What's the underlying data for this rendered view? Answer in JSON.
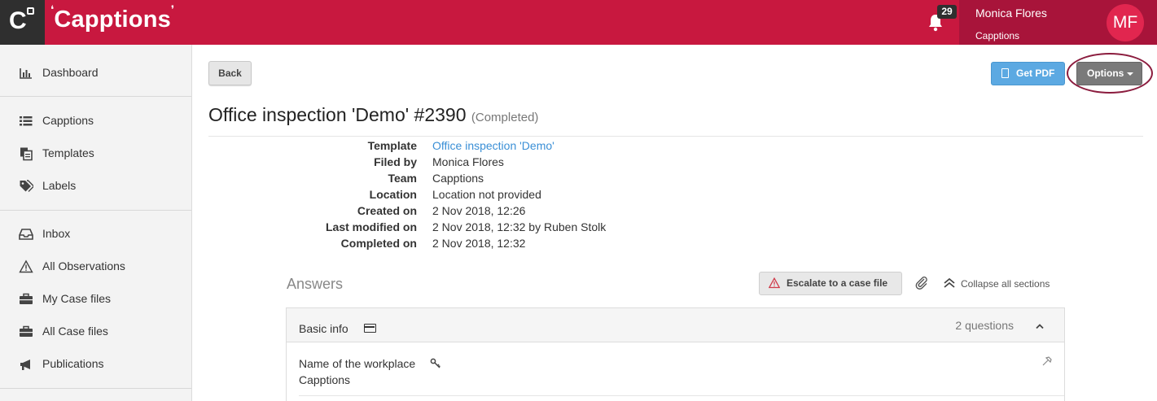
{
  "header": {
    "brand": "Capptions",
    "notification_count": "29",
    "user_name": "Monica Flores",
    "user_team": "Capptions",
    "user_initials": "MF"
  },
  "sidebar": {
    "items": [
      {
        "label": "Dashboard",
        "icon": "bar-chart-icon"
      },
      {
        "label": "Capptions",
        "icon": "list-icon"
      },
      {
        "label": "Templates",
        "icon": "copy-icon"
      },
      {
        "label": "Labels",
        "icon": "tags-icon"
      },
      {
        "label": "Inbox",
        "icon": "inbox-icon"
      },
      {
        "label": "All Observations",
        "icon": "warning-icon"
      },
      {
        "label": "My Case files",
        "icon": "briefcase-icon"
      },
      {
        "label": "All Case files",
        "icon": "briefcase-icon"
      },
      {
        "label": "Publications",
        "icon": "bullhorn-icon"
      }
    ]
  },
  "toolbar": {
    "back_label": "Back",
    "pdf_label": "Get PDF",
    "options_label": "Options"
  },
  "page": {
    "title": "Office inspection 'Demo' #2390",
    "status": "(Completed)"
  },
  "meta": [
    {
      "key": "Template",
      "value": "Office inspection 'Demo'"
    },
    {
      "key": "Filed by",
      "value": "Monica Flores"
    },
    {
      "key": "Team",
      "value": "Capptions"
    },
    {
      "key": "Location",
      "value": "Location not provided"
    },
    {
      "key": "Created on",
      "value": "2 Nov 2018, 12:26"
    },
    {
      "key": "Last modified on",
      "value": "2 Nov 2018, 12:32 by Ruben Stolk"
    },
    {
      "key": "Completed on",
      "value": "2 Nov 2018, 12:32"
    }
  ],
  "answers": {
    "heading": "Answers",
    "escalate_label": "Escalate to a case file",
    "collapse_label": "Collapse all sections",
    "section": {
      "title": "Basic info",
      "count": "2 questions",
      "question": "Name of the workplace",
      "answer": "Capptions"
    }
  },
  "colors": {
    "brand": "#c8183f",
    "user_panel": "#a8143a",
    "link": "#3a8fd6",
    "pdf_button": "#5ca9e2",
    "options_button": "#7a7a7a",
    "highlight_ring": "#8b1c3e"
  }
}
